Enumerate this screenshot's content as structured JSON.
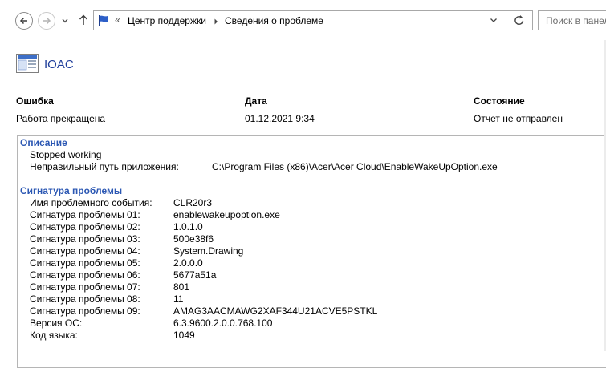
{
  "nav": {
    "breadcrumb_prefix": "«",
    "breadcrumb": [
      "Центр поддержки",
      "Сведения о проблеме"
    ],
    "search_placeholder": "Поиск в панеле"
  },
  "app": {
    "name": "IOAC"
  },
  "summary": {
    "error_label": "Ошибка",
    "error_value": "Работа прекращена",
    "date_label": "Дата",
    "date_value": "01.12.2021 9:34",
    "status_label": "Состояние",
    "status_value": "Отчет не отправлен"
  },
  "description": {
    "heading": "Описание",
    "line1": "Stopped working",
    "path_label": "Неправильный путь приложения:",
    "path_value": "C:\\Program Files (x86)\\Acer\\Acer Cloud\\EnableWakeUpOption.exe"
  },
  "signature": {
    "heading": "Сигнатура проблемы",
    "rows": [
      {
        "label": "Имя проблемного события:",
        "value": "CLR20r3"
      },
      {
        "label": "Сигнатура проблемы 01:",
        "value": "enablewakeupoption.exe"
      },
      {
        "label": "Сигнатура проблемы 02:",
        "value": "1.0.1.0"
      },
      {
        "label": "Сигнатура проблемы 03:",
        "value": "500e38f6"
      },
      {
        "label": "Сигнатура проблемы 04:",
        "value": "System.Drawing"
      },
      {
        "label": "Сигнатура проблемы 05:",
        "value": "2.0.0.0"
      },
      {
        "label": "Сигнатура проблемы 06:",
        "value": "5677a51a"
      },
      {
        "label": "Сигнатура проблемы 07:",
        "value": "801"
      },
      {
        "label": "Сигнатура проблемы 08:",
        "value": "11"
      },
      {
        "label": "Сигнатура проблемы 09:",
        "value": "AMAG3AACMAWG2XAF344U21ACVE5PSTKL"
      },
      {
        "label": "Версия ОС:",
        "value": "6.3.9600.2.0.0.768.100"
      },
      {
        "label": "Код языка:",
        "value": "1049"
      }
    ]
  },
  "colors": {
    "link_blue": "#2b57b3",
    "title_blue": "#1e3d9a"
  }
}
